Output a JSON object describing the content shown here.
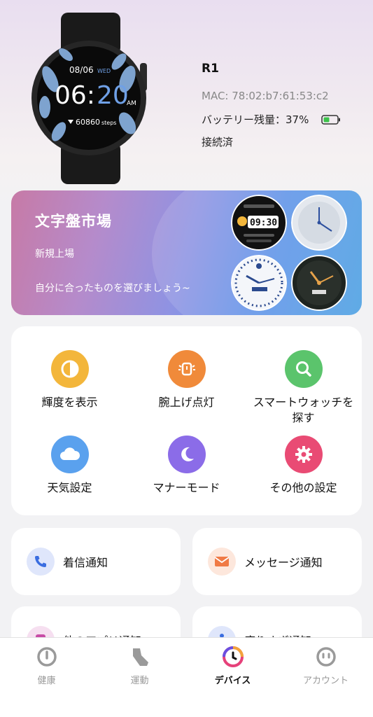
{
  "device": {
    "name": "R1",
    "mac": "MAC: 78:02:b7:61:53:c2",
    "battery": "バッテリー残量：37%",
    "status": "接続済",
    "watch_face": {
      "date": "08/06",
      "day": "WED",
      "hour": "06:",
      "minute": "20",
      "ampm": "AM",
      "steps": "60860",
      "steps_unit": "steps"
    }
  },
  "banner": {
    "title": "文字盤市場",
    "subtitle": "新規上場",
    "description": "自分に合ったものを選びましょう~",
    "face1_time": "09:30"
  },
  "functions": [
    {
      "label": "輝度を表示",
      "icon": "brightness-icon",
      "color": "#f3b63b"
    },
    {
      "label": "腕上げ点灯",
      "icon": "wrist-raise-icon",
      "color": "#f08a3a"
    },
    {
      "label": "スマートウォッチを探す",
      "icon": "search-icon",
      "color": "#5bc46c"
    },
    {
      "label": "天気設定",
      "icon": "cloud-icon",
      "color": "#5aa1ee"
    },
    {
      "label": "マナーモード",
      "icon": "moon-icon",
      "color": "#8b6ce8"
    },
    {
      "label": "その他の設定",
      "icon": "gear-icon",
      "color": "#e94b74"
    }
  ],
  "notifications": [
    {
      "label": "着信通知",
      "icon": "phone-icon"
    },
    {
      "label": "メッセージ通知",
      "icon": "envelope-icon"
    },
    {
      "label": "他のアプリ通知",
      "icon": "app-icon"
    },
    {
      "label": "座りすぎ通知",
      "icon": "person-icon"
    }
  ],
  "tabs": [
    {
      "label": "健康",
      "icon": "health-icon",
      "active": false
    },
    {
      "label": "運動",
      "icon": "shoe-icon",
      "active": false
    },
    {
      "label": "デバイス",
      "icon": "device-icon",
      "active": true
    },
    {
      "label": "アカウント",
      "icon": "account-icon",
      "active": false
    }
  ]
}
